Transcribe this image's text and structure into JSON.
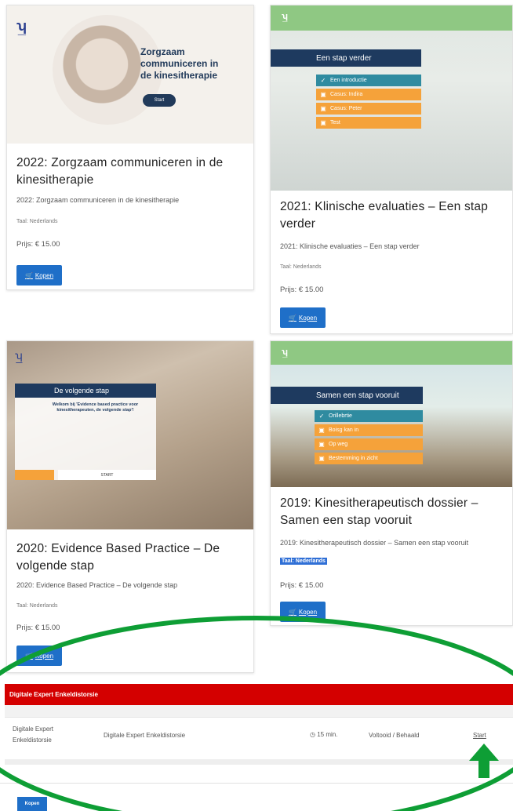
{
  "colors": {
    "accent_blue": "#1f6fc8",
    "module_red": "#d40000",
    "annotation_green": "#0e9e35",
    "menu_teal": "#2f8ba0",
    "menu_orange": "#f5a23a",
    "navy": "#1e3a5f",
    "header_green": "#8fc883"
  },
  "cards": [
    {
      "title": "2022: Zorgzaam communiceren in de kinesitherapie",
      "subtitle": "2022: Zorgzaam communiceren in de kinesitherapie",
      "language": "Taal: Nederlands",
      "price": "Prijs: € 15.00",
      "buy_label": "Kopen",
      "thumb": {
        "heading": "Zorgzaam communiceren in de kinesitherapie",
        "button": "Start"
      }
    },
    {
      "title": "2021: Klinische evaluaties – Een stap verder",
      "subtitle": "2021: Klinische evaluaties – Een stap verder",
      "language": "Taal: Nederlands",
      "price": "Prijs: € 15.00",
      "buy_label": "Kopen",
      "thumb": {
        "heading": "Een stap verder",
        "items": [
          "Een introductie",
          "Casus: Indira",
          "Casus: Peter",
          "Test"
        ]
      }
    },
    {
      "title": "2020: Evidence Based Practice – De volgende stap",
      "subtitle": "2020: Evidence Based Practice – De volgende stap",
      "language": "Taal: Nederlands",
      "price": "Prijs: € 15.00",
      "buy_label": "Kopen",
      "thumb": {
        "heading": "De volgende stap",
        "question": "Welkom bij 'Evidence based practice voor kinesitherapeuten, de volgende stap'!",
        "start": "START"
      }
    },
    {
      "title": "2019: Kinesitherapeutisch dossier – Samen een stap vooruit",
      "subtitle": "2019: Kinesitherapeutisch dossier – Samen een stap vooruit",
      "language": "Taal: Nederlands",
      "price": "Prijs: € 15.00",
      "buy_label": "Kopen",
      "thumb": {
        "heading": "Samen een stap vooruit",
        "items": [
          "Orillebrtie",
          "Boisg kan in",
          "Op weg",
          "Bestemming in zicht"
        ]
      }
    }
  ],
  "module": {
    "header": "Digitale Expert Enkeldistorsie",
    "row": {
      "name": "Digitale Expert Enkeldistorsie",
      "description": "Digitale Expert Enkeldistorsie",
      "duration": "15 min.",
      "status": "Voltooid / Behaald",
      "action": "Start"
    }
  },
  "bottom_button": "Kopen"
}
